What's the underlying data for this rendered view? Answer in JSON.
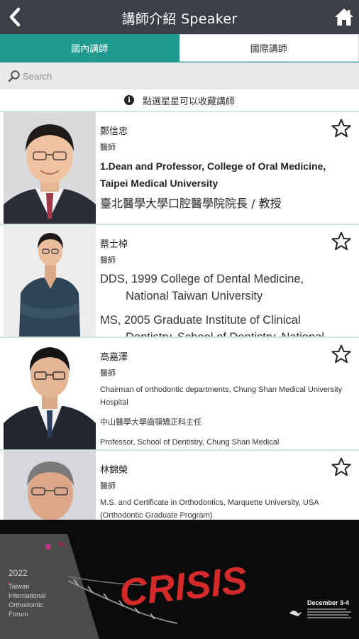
{
  "header": {
    "title": "講師介紹 Speaker"
  },
  "tabs": [
    {
      "label": "國內講師",
      "active": true
    },
    {
      "label": "國際講師",
      "active": false
    }
  ],
  "search": {
    "placeholder": "Search"
  },
  "hint": {
    "text": "點選星星可以收藏講師"
  },
  "speakers": [
    {
      "name": "鄭信忠",
      "role": "醫師",
      "bio": [
        "1.Dean and Professor, College of Oral Medicine, Taipei Medical University",
        "臺北醫學大學口腔醫學院院長 / 教授"
      ]
    },
    {
      "name": "蔡士棹",
      "role": "醫師",
      "bio": [
        "DDS, 1999 College of Dental Medicine,",
        "National Taiwan University",
        "MS, 2005 Graduate Institute of Clinical",
        "Dentistry, School of Dentistry, National"
      ]
    },
    {
      "name": "高嘉澤",
      "role": "醫師",
      "bio": [
        "Chairman of orthodontic departments, Chung Shan Medical University Hospital",
        "中山醫學大學齒顎矯正科主任",
        "Professor, School of Dentistry, Chung Shan Medical"
      ]
    },
    {
      "name": "林錦榮",
      "role": "醫師",
      "bio": [
        "M.S. and Certificate in Orthodontics, Marquette University, USA (Orthodontic Graduate Program)"
      ]
    }
  ],
  "banner": {
    "year": "2022",
    "forum_lines": [
      "Taiwan",
      "International",
      "Orthodontic",
      "Forum"
    ],
    "headline": "CRISIS",
    "date": "December 3-4"
  },
  "colors": {
    "header": "#3a4046",
    "accent": "#1e9a8e",
    "search_bg": "#e8e9ea",
    "banner_red": "#d42a2a"
  }
}
